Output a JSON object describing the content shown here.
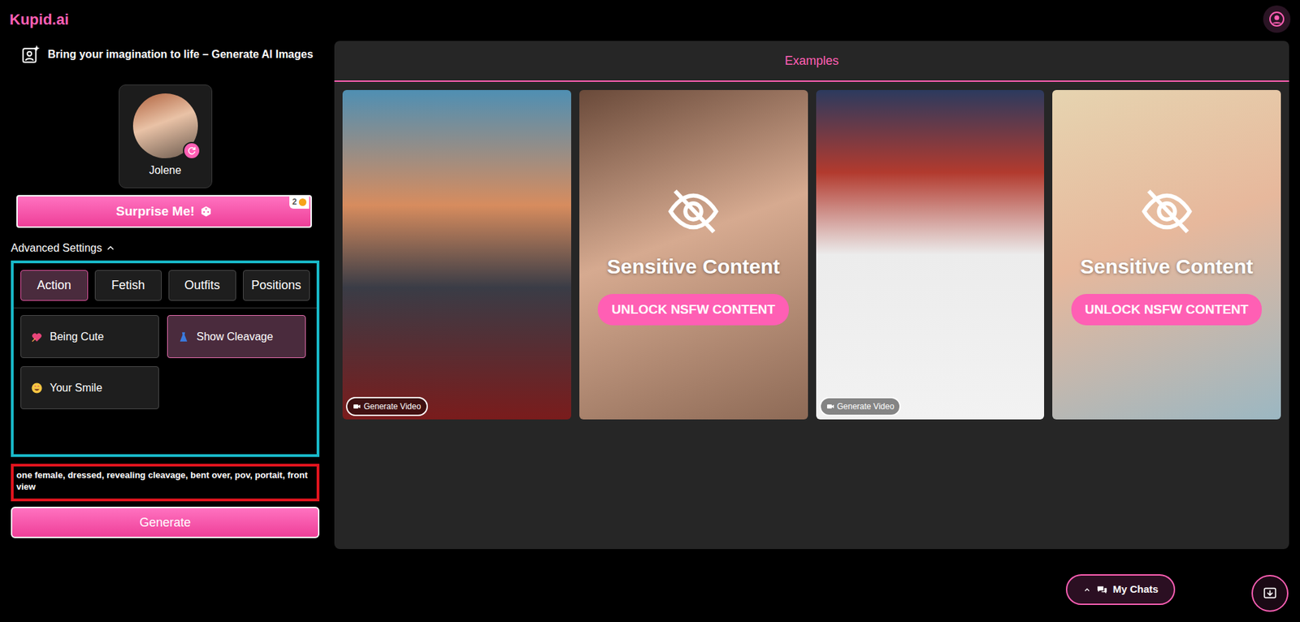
{
  "logo": "Kupid.ai",
  "header": {
    "title": "Bring your imagination to life – Generate AI Images"
  },
  "character": {
    "name": "Jolene"
  },
  "surprise": {
    "label": "Surprise Me!",
    "count": "2"
  },
  "advanced": {
    "label": "Advanced Settings",
    "expanded": true
  },
  "categories": [
    {
      "label": "Action",
      "selected": true
    },
    {
      "label": "Fetish",
      "selected": false
    },
    {
      "label": "Outfits",
      "selected": false
    },
    {
      "label": "Positions",
      "selected": false
    }
  ],
  "options": [
    {
      "label": "Being Cute",
      "selected": false
    },
    {
      "label": "Show Cleavage",
      "selected": true
    },
    {
      "label": "Your Smile",
      "selected": false
    }
  ],
  "prompt": "one female, dressed, revealing cleavage, bent over, pov, portait, front view",
  "generate": "Generate",
  "examples": {
    "title": "Examples",
    "items": [
      {
        "kind": "photo",
        "button": "Generate Video"
      },
      {
        "kind": "locked",
        "warning": "Sensitive Content",
        "button": "UNLOCK NSFW CONTENT"
      },
      {
        "kind": "photo",
        "button": "Generate Video"
      },
      {
        "kind": "locked",
        "warning": "Sensitive Content",
        "button": "UNLOCK NSFW CONTENT"
      }
    ]
  },
  "my_chats": "My Chats"
}
